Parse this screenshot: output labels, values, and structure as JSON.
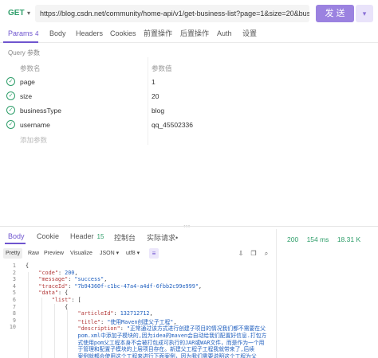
{
  "request": {
    "method": "GET",
    "url": "https://blog.csdn.net/community/home-api/v1/get-business-list?page=1&size=20&businessType=",
    "send_label": "发 送"
  },
  "request_tabs": [
    {
      "label": "Params",
      "badge": "4"
    },
    {
      "label": "Body"
    },
    {
      "label": "Headers"
    },
    {
      "label": "Cookies"
    },
    {
      "label": "前置操作"
    },
    {
      "label": "后置操作"
    },
    {
      "label": "Auth"
    },
    {
      "label": "设置"
    }
  ],
  "query_title": "Query 参数",
  "params": {
    "header_name": "参数名",
    "header_value": "参数值",
    "rows": [
      {
        "name": "page",
        "value": "1"
      },
      {
        "name": "size",
        "value": "20"
      },
      {
        "name": "businessType",
        "value": "blog"
      },
      {
        "name": "username",
        "value": "qq_45502336"
      }
    ],
    "add_placeholder": "添加参数"
  },
  "response_tabs": [
    {
      "label": "Body"
    },
    {
      "label": "Cookie"
    },
    {
      "label": "Header",
      "badge": "15"
    },
    {
      "label": "控制台"
    },
    {
      "label": "实际请求•"
    }
  ],
  "stats": {
    "status": "200",
    "time": "154 ms",
    "size": "18.31 K"
  },
  "toolbar": {
    "formats": [
      "Pretty",
      "Raw",
      "Preview",
      "Visualize"
    ],
    "type": "JSON",
    "encoding": "utf8"
  },
  "code_line_numbers": [
    "1",
    "2",
    "3",
    "4",
    "5",
    "6",
    "7",
    "8",
    "9",
    "10",
    "",
    "",
    "",
    "",
    ""
  ],
  "colors": {
    "accent": "#6f55cf",
    "send": "#9b82e0",
    "success": "#2f9e6a"
  }
}
